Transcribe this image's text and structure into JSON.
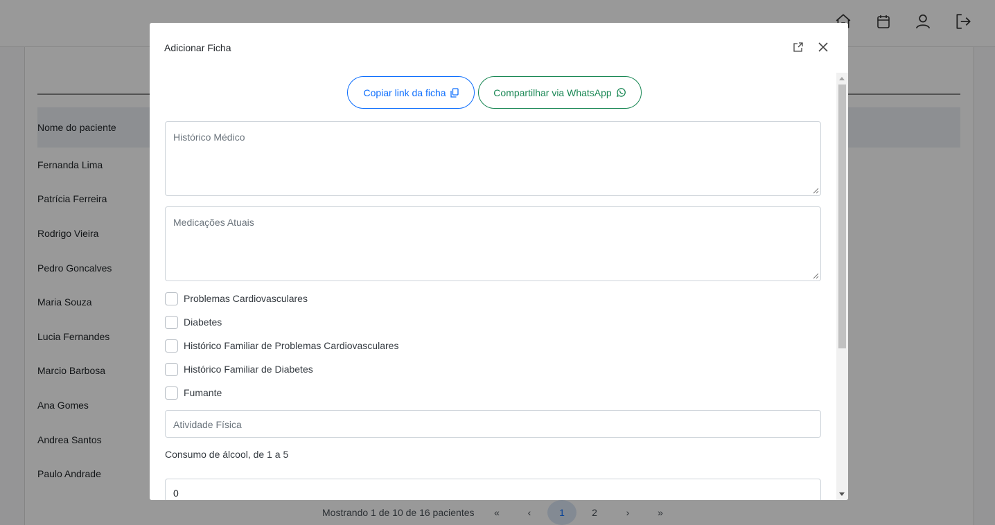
{
  "background": {
    "nav_icons": [
      "home-icon",
      "calendar-icon",
      "user-icon",
      "logout-icon"
    ],
    "table": {
      "column_header": "Nome do paciente",
      "rows": [
        "Fernanda Lima",
        "Patrícia Ferreira",
        "Rodrigo Vieira",
        "Pedro Goncalves",
        "Maria Souza",
        "Lucia Fernandes",
        "Marcio Barbosa",
        "Ana Gomes",
        "Andrea Santos",
        "Paulo Andrade"
      ]
    },
    "pagination": {
      "info": "Mostrando 1 de 10 de 16 pacientes",
      "first": "«",
      "prev": "‹",
      "pages": [
        "1",
        "2"
      ],
      "active_page": "1",
      "next": "›",
      "last": "»"
    }
  },
  "modal": {
    "title": "Adicionar Ficha",
    "copy_link_label": "Copiar link da ficha",
    "whatsapp_label": "Compartilhar via WhatsApp",
    "medical_history_placeholder": "Histórico Médico",
    "current_medications_placeholder": "Medicações Atuais",
    "checkboxes": [
      {
        "label": "Problemas Cardiovasculares",
        "checked": false
      },
      {
        "label": "Diabetes",
        "checked": false
      },
      {
        "label": "Histórico Familiar de Problemas Cardiovasculares",
        "checked": false
      },
      {
        "label": "Histórico Familiar de Diabetes",
        "checked": false
      },
      {
        "label": "Fumante",
        "checked": false
      }
    ],
    "physical_activity_placeholder": "Atividade Física",
    "alcohol_label": "Consumo de álcool, de 1 a 5",
    "alcohol_value": "0"
  },
  "colors": {
    "primary": "#0d6efd",
    "whatsapp": "#198754",
    "overlay": "rgba(0,0,0,0.40)"
  }
}
